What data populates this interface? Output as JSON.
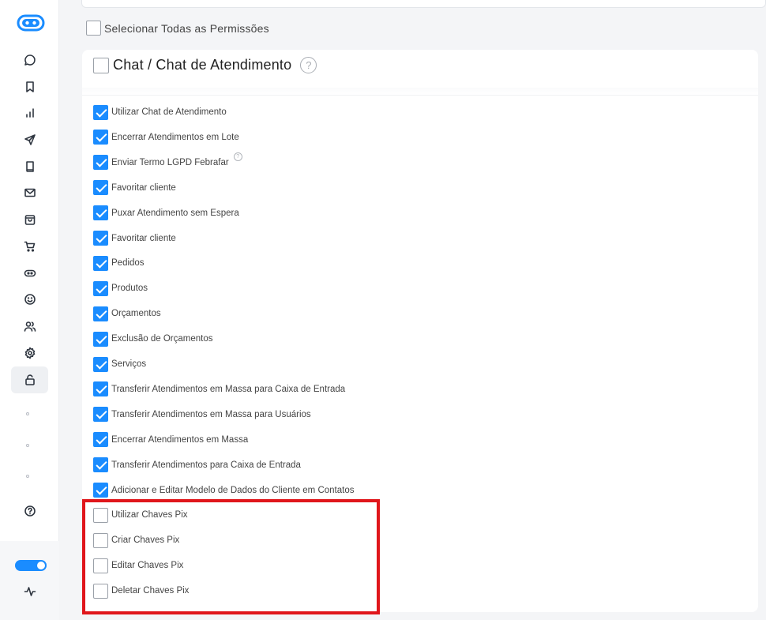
{
  "sidebar": {
    "nav_icons": [
      "chat-icon",
      "bookmark-icon",
      "bar-chart-icon",
      "send-icon",
      "book-icon",
      "mail-icon",
      "bag-icon",
      "cart-icon",
      "bot-icon",
      "smile-icon",
      "users-icon",
      "settings-icon",
      "unlock-icon"
    ],
    "active_item": "unlock-icon",
    "bottom_icons": [
      "help-circle-icon",
      "activity-icon"
    ],
    "toggle_on": true
  },
  "permissions_page": {
    "select_all_label": "Selecionar Todas as Permissões",
    "section_title": "Chat / Chat de Atendimento",
    "section_help": "?",
    "items": [
      {
        "label": "Utilizar Chat de Atendimento",
        "checked": true
      },
      {
        "label": "Encerrar Atendimentos em Lote",
        "checked": true
      },
      {
        "label": "Enviar Termo LGPD Febrafar",
        "checked": true,
        "help": "?"
      },
      {
        "label": "Favoritar cliente",
        "checked": true
      },
      {
        "label": "Puxar Atendimento sem Espera",
        "checked": true
      },
      {
        "label": "Favoritar cliente",
        "checked": true
      },
      {
        "label": "Pedidos",
        "checked": true
      },
      {
        "label": "Produtos",
        "checked": true
      },
      {
        "label": "Orçamentos",
        "checked": true
      },
      {
        "label": "Exclusão de Orçamentos",
        "checked": true
      },
      {
        "label": "Serviços",
        "checked": true
      },
      {
        "label": "Transferir Atendimentos em Massa para Caixa de Entrada",
        "checked": true
      },
      {
        "label": "Transferir Atendimentos em Massa para Usuários",
        "checked": true
      },
      {
        "label": "Encerrar Atendimentos em Massa",
        "checked": true
      },
      {
        "label": "Transferir Atendimentos para Caixa de Entrada",
        "checked": true
      },
      {
        "label": "Adicionar e Editar Modelo de Dados do Cliente em Contatos",
        "checked": true
      },
      {
        "label": "Utilizar Chaves Pix",
        "checked": false
      },
      {
        "label": "Criar Chaves Pix",
        "checked": false
      },
      {
        "label": "Editar Chaves Pix",
        "checked": false
      },
      {
        "label": "Deletar Chaves Pix",
        "checked": false
      }
    ]
  },
  "colors": {
    "accent": "#1a8cff",
    "highlight": "#e0161b"
  }
}
